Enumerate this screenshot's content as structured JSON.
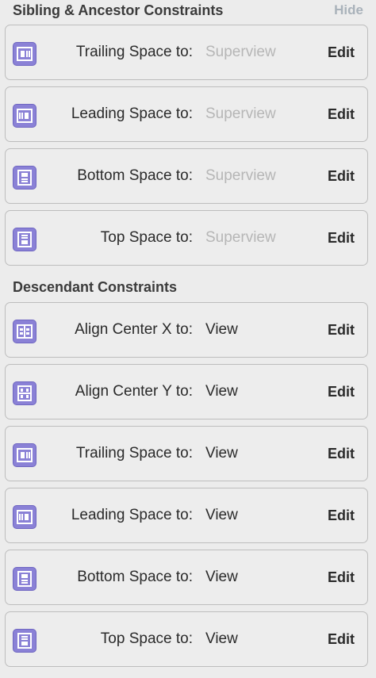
{
  "sibling_section": {
    "title": "Sibling & Ancestor Constraints",
    "hide_label": "Hide",
    "items": [
      {
        "label": "Trailing Space to:",
        "target": "Superview",
        "edit": "Edit",
        "icon": "trailing-space-icon"
      },
      {
        "label": "Leading Space to:",
        "target": "Superview",
        "edit": "Edit",
        "icon": "leading-space-icon"
      },
      {
        "label": "Bottom Space to:",
        "target": "Superview",
        "edit": "Edit",
        "icon": "bottom-space-icon"
      },
      {
        "label": "Top Space to:",
        "target": "Superview",
        "edit": "Edit",
        "icon": "top-space-icon"
      }
    ]
  },
  "descendant_section": {
    "title": "Descendant Constraints",
    "items": [
      {
        "label": "Align Center X to:",
        "target": "View",
        "edit": "Edit",
        "icon": "align-center-x-icon"
      },
      {
        "label": "Align Center Y to:",
        "target": "View",
        "edit": "Edit",
        "icon": "align-center-y-icon"
      },
      {
        "label": "Trailing Space to:",
        "target": "View",
        "edit": "Edit",
        "icon": "trailing-space-icon"
      },
      {
        "label": "Leading Space to:",
        "target": "View",
        "edit": "Edit",
        "icon": "leading-space-icon"
      },
      {
        "label": "Bottom Space to:",
        "target": "View",
        "edit": "Edit",
        "icon": "bottom-space-icon"
      },
      {
        "label": "Top Space to:",
        "target": "View",
        "edit": "Edit",
        "icon": "top-space-icon"
      }
    ]
  },
  "colors": {
    "icon_fill": "#8a81d6",
    "muted_text": "#b6b6b6",
    "hide_link": "#a9b2ba"
  }
}
